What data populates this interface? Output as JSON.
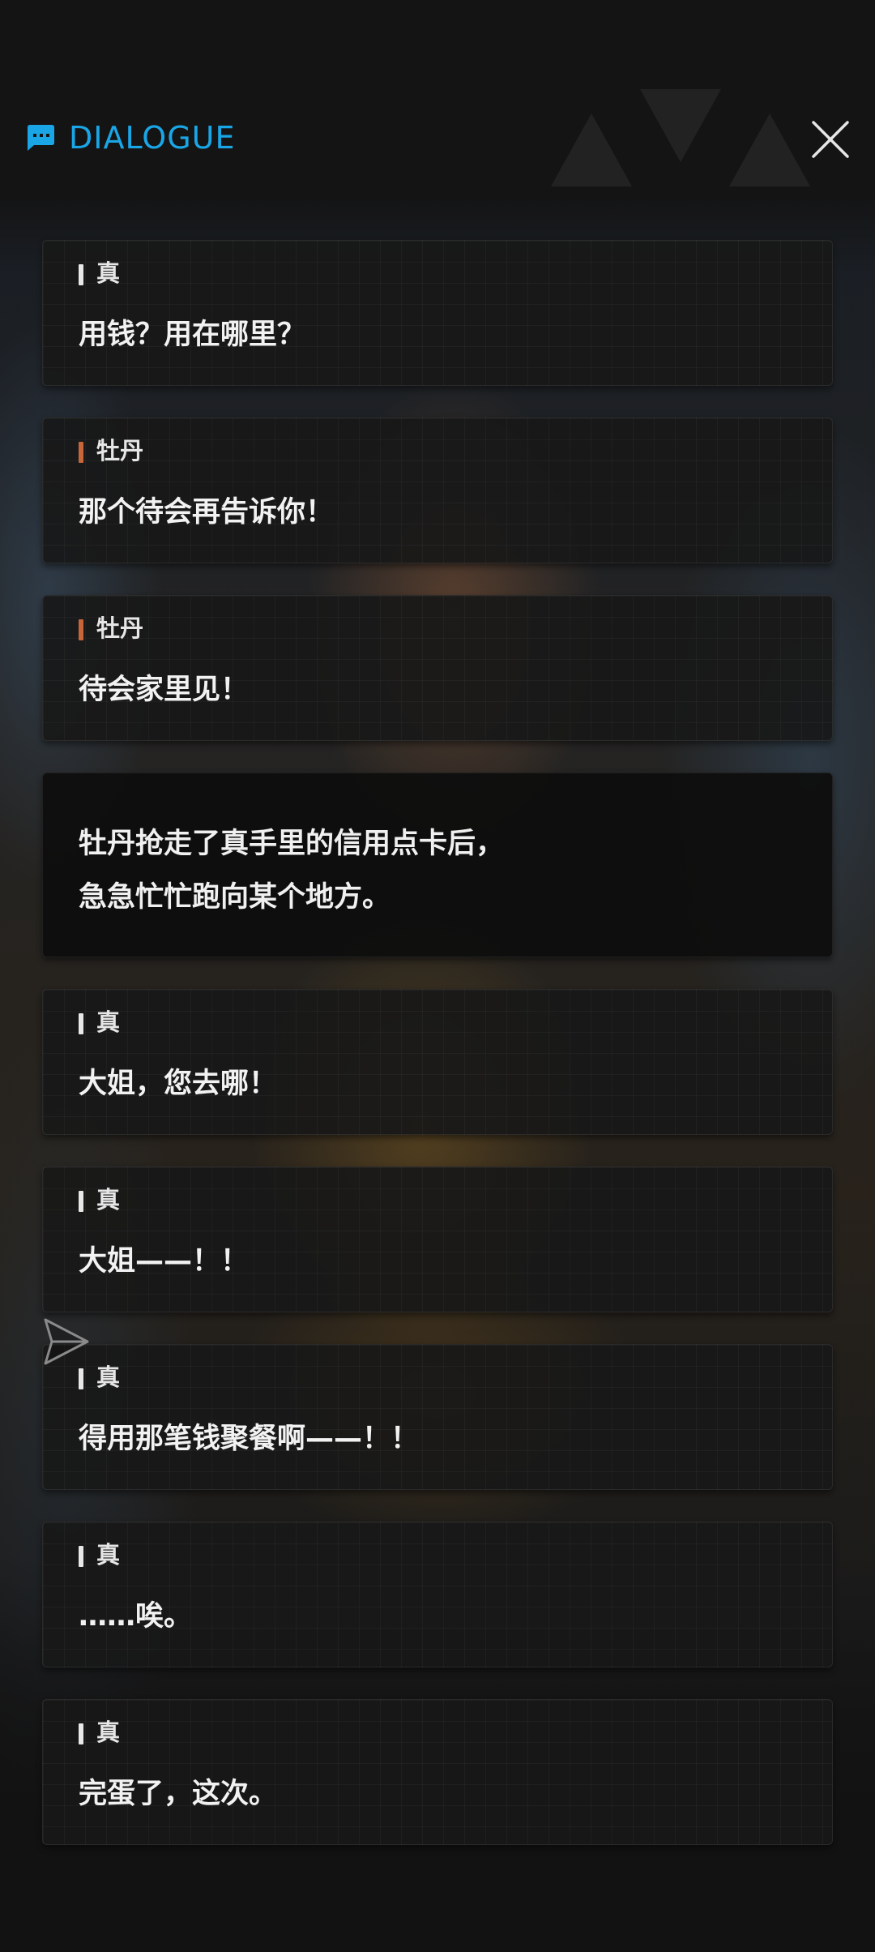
{
  "header": {
    "title": "DIALOGUE",
    "accent_color": "#1aa6e6",
    "icon": "chat-bubble-icon",
    "close_icon": "close-icon"
  },
  "colors": {
    "speaker_zhen": "#e8e8e8",
    "speaker_mudan": "#c8663a"
  },
  "entries": [
    {
      "type": "line",
      "speaker": "真",
      "text": "用钱？用在哪里？"
    },
    {
      "type": "line",
      "speaker": "牡丹",
      "text": "那个待会再告诉你！"
    },
    {
      "type": "line",
      "speaker": "牡丹",
      "text": "待会家里见！"
    },
    {
      "type": "narration",
      "lines": [
        "牡丹抢走了真手里的信用点卡后，",
        "急急忙忙跑向某个地方。"
      ]
    },
    {
      "type": "line",
      "speaker": "真",
      "text": "大姐，您去哪！"
    },
    {
      "type": "line",
      "speaker": "真",
      "text": "大姐——！！"
    },
    {
      "type": "line",
      "speaker": "真",
      "text": "得用那笔钱聚餐啊——！！"
    },
    {
      "type": "line",
      "speaker": "真",
      "text": "……唉。"
    },
    {
      "type": "line",
      "speaker": "真",
      "text": "完蛋了，这次。"
    }
  ],
  "share_icon": "send-icon"
}
